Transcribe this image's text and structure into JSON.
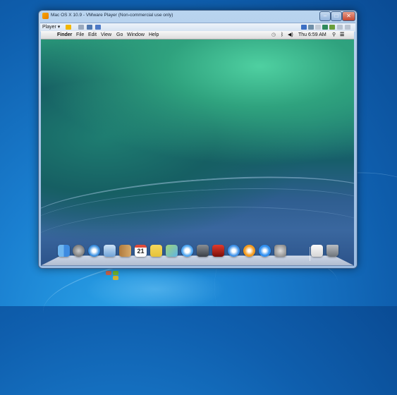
{
  "window": {
    "title": "Mac OS X 10.9 - VMware Player (Non-commercial use only)",
    "toolbar_menu": "Player ▾"
  },
  "mac_menubar": {
    "apple_symbol": "",
    "app_name": "Finder",
    "items": [
      "File",
      "Edit",
      "View",
      "Go",
      "Window",
      "Help"
    ],
    "clock": "Thu 6:59 AM"
  },
  "dock": {
    "apps": [
      "Finder",
      "Launchpad",
      "Safari",
      "Mail",
      "Contacts",
      "Calendar",
      "Notes",
      "Maps",
      "Messages",
      "FaceTime",
      "Photo Booth",
      "iTunes",
      "iBooks",
      "App Store",
      "System Preferences",
      "Documents",
      "Trash"
    ],
    "calendar_day": "21"
  },
  "colors": {
    "dock_finder": "#3e8be0",
    "dock_close": "#c6462f"
  }
}
